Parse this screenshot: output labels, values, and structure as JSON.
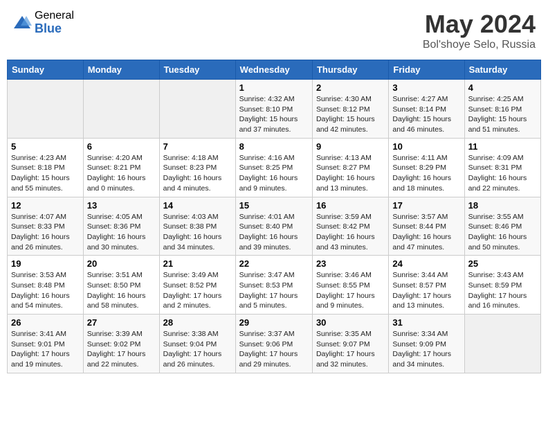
{
  "header": {
    "logo_general": "General",
    "logo_blue": "Blue",
    "month_title": "May 2024",
    "location": "Bol'shoye Selo, Russia"
  },
  "weekdays": [
    "Sunday",
    "Monday",
    "Tuesday",
    "Wednesday",
    "Thursday",
    "Friday",
    "Saturday"
  ],
  "weeks": [
    [
      {
        "day": "",
        "info": ""
      },
      {
        "day": "",
        "info": ""
      },
      {
        "day": "",
        "info": ""
      },
      {
        "day": "1",
        "info": "Sunrise: 4:32 AM\nSunset: 8:10 PM\nDaylight: 15 hours and 37 minutes."
      },
      {
        "day": "2",
        "info": "Sunrise: 4:30 AM\nSunset: 8:12 PM\nDaylight: 15 hours and 42 minutes."
      },
      {
        "day": "3",
        "info": "Sunrise: 4:27 AM\nSunset: 8:14 PM\nDaylight: 15 hours and 46 minutes."
      },
      {
        "day": "4",
        "info": "Sunrise: 4:25 AM\nSunset: 8:16 PM\nDaylight: 15 hours and 51 minutes."
      }
    ],
    [
      {
        "day": "5",
        "info": "Sunrise: 4:23 AM\nSunset: 8:18 PM\nDaylight: 15 hours and 55 minutes."
      },
      {
        "day": "6",
        "info": "Sunrise: 4:20 AM\nSunset: 8:21 PM\nDaylight: 16 hours and 0 minutes."
      },
      {
        "day": "7",
        "info": "Sunrise: 4:18 AM\nSunset: 8:23 PM\nDaylight: 16 hours and 4 minutes."
      },
      {
        "day": "8",
        "info": "Sunrise: 4:16 AM\nSunset: 8:25 PM\nDaylight: 16 hours and 9 minutes."
      },
      {
        "day": "9",
        "info": "Sunrise: 4:13 AM\nSunset: 8:27 PM\nDaylight: 16 hours and 13 minutes."
      },
      {
        "day": "10",
        "info": "Sunrise: 4:11 AM\nSunset: 8:29 PM\nDaylight: 16 hours and 18 minutes."
      },
      {
        "day": "11",
        "info": "Sunrise: 4:09 AM\nSunset: 8:31 PM\nDaylight: 16 hours and 22 minutes."
      }
    ],
    [
      {
        "day": "12",
        "info": "Sunrise: 4:07 AM\nSunset: 8:33 PM\nDaylight: 16 hours and 26 minutes."
      },
      {
        "day": "13",
        "info": "Sunrise: 4:05 AM\nSunset: 8:36 PM\nDaylight: 16 hours and 30 minutes."
      },
      {
        "day": "14",
        "info": "Sunrise: 4:03 AM\nSunset: 8:38 PM\nDaylight: 16 hours and 34 minutes."
      },
      {
        "day": "15",
        "info": "Sunrise: 4:01 AM\nSunset: 8:40 PM\nDaylight: 16 hours and 39 minutes."
      },
      {
        "day": "16",
        "info": "Sunrise: 3:59 AM\nSunset: 8:42 PM\nDaylight: 16 hours and 43 minutes."
      },
      {
        "day": "17",
        "info": "Sunrise: 3:57 AM\nSunset: 8:44 PM\nDaylight: 16 hours and 47 minutes."
      },
      {
        "day": "18",
        "info": "Sunrise: 3:55 AM\nSunset: 8:46 PM\nDaylight: 16 hours and 50 minutes."
      }
    ],
    [
      {
        "day": "19",
        "info": "Sunrise: 3:53 AM\nSunset: 8:48 PM\nDaylight: 16 hours and 54 minutes."
      },
      {
        "day": "20",
        "info": "Sunrise: 3:51 AM\nSunset: 8:50 PM\nDaylight: 16 hours and 58 minutes."
      },
      {
        "day": "21",
        "info": "Sunrise: 3:49 AM\nSunset: 8:52 PM\nDaylight: 17 hours and 2 minutes."
      },
      {
        "day": "22",
        "info": "Sunrise: 3:47 AM\nSunset: 8:53 PM\nDaylight: 17 hours and 5 minutes."
      },
      {
        "day": "23",
        "info": "Sunrise: 3:46 AM\nSunset: 8:55 PM\nDaylight: 17 hours and 9 minutes."
      },
      {
        "day": "24",
        "info": "Sunrise: 3:44 AM\nSunset: 8:57 PM\nDaylight: 17 hours and 13 minutes."
      },
      {
        "day": "25",
        "info": "Sunrise: 3:43 AM\nSunset: 8:59 PM\nDaylight: 17 hours and 16 minutes."
      }
    ],
    [
      {
        "day": "26",
        "info": "Sunrise: 3:41 AM\nSunset: 9:01 PM\nDaylight: 17 hours and 19 minutes."
      },
      {
        "day": "27",
        "info": "Sunrise: 3:39 AM\nSunset: 9:02 PM\nDaylight: 17 hours and 22 minutes."
      },
      {
        "day": "28",
        "info": "Sunrise: 3:38 AM\nSunset: 9:04 PM\nDaylight: 17 hours and 26 minutes."
      },
      {
        "day": "29",
        "info": "Sunrise: 3:37 AM\nSunset: 9:06 PM\nDaylight: 17 hours and 29 minutes."
      },
      {
        "day": "30",
        "info": "Sunrise: 3:35 AM\nSunset: 9:07 PM\nDaylight: 17 hours and 32 minutes."
      },
      {
        "day": "31",
        "info": "Sunrise: 3:34 AM\nSunset: 9:09 PM\nDaylight: 17 hours and 34 minutes."
      },
      {
        "day": "",
        "info": ""
      }
    ]
  ]
}
